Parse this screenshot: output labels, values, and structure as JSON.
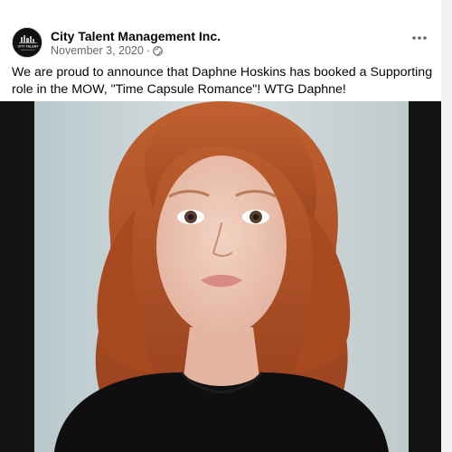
{
  "post": {
    "page_name": "City Talent Management Inc.",
    "date": "November 3, 2020",
    "separator": "·",
    "audience_icon": "globe-icon",
    "more_icon": "more-options-icon",
    "body_text": "We are proud to announce that Daphne Hoskins has booked a Supporting role in the MOW, \"Time Capsule Romance\"! WTG Daphne!",
    "avatar": {
      "logo_text": "CITY TALENT"
    }
  },
  "colors": {
    "primary_text": "#050505",
    "secondary_text": "#65676b",
    "hair": "#b4532a",
    "background_photo": "#c9d3d6"
  }
}
